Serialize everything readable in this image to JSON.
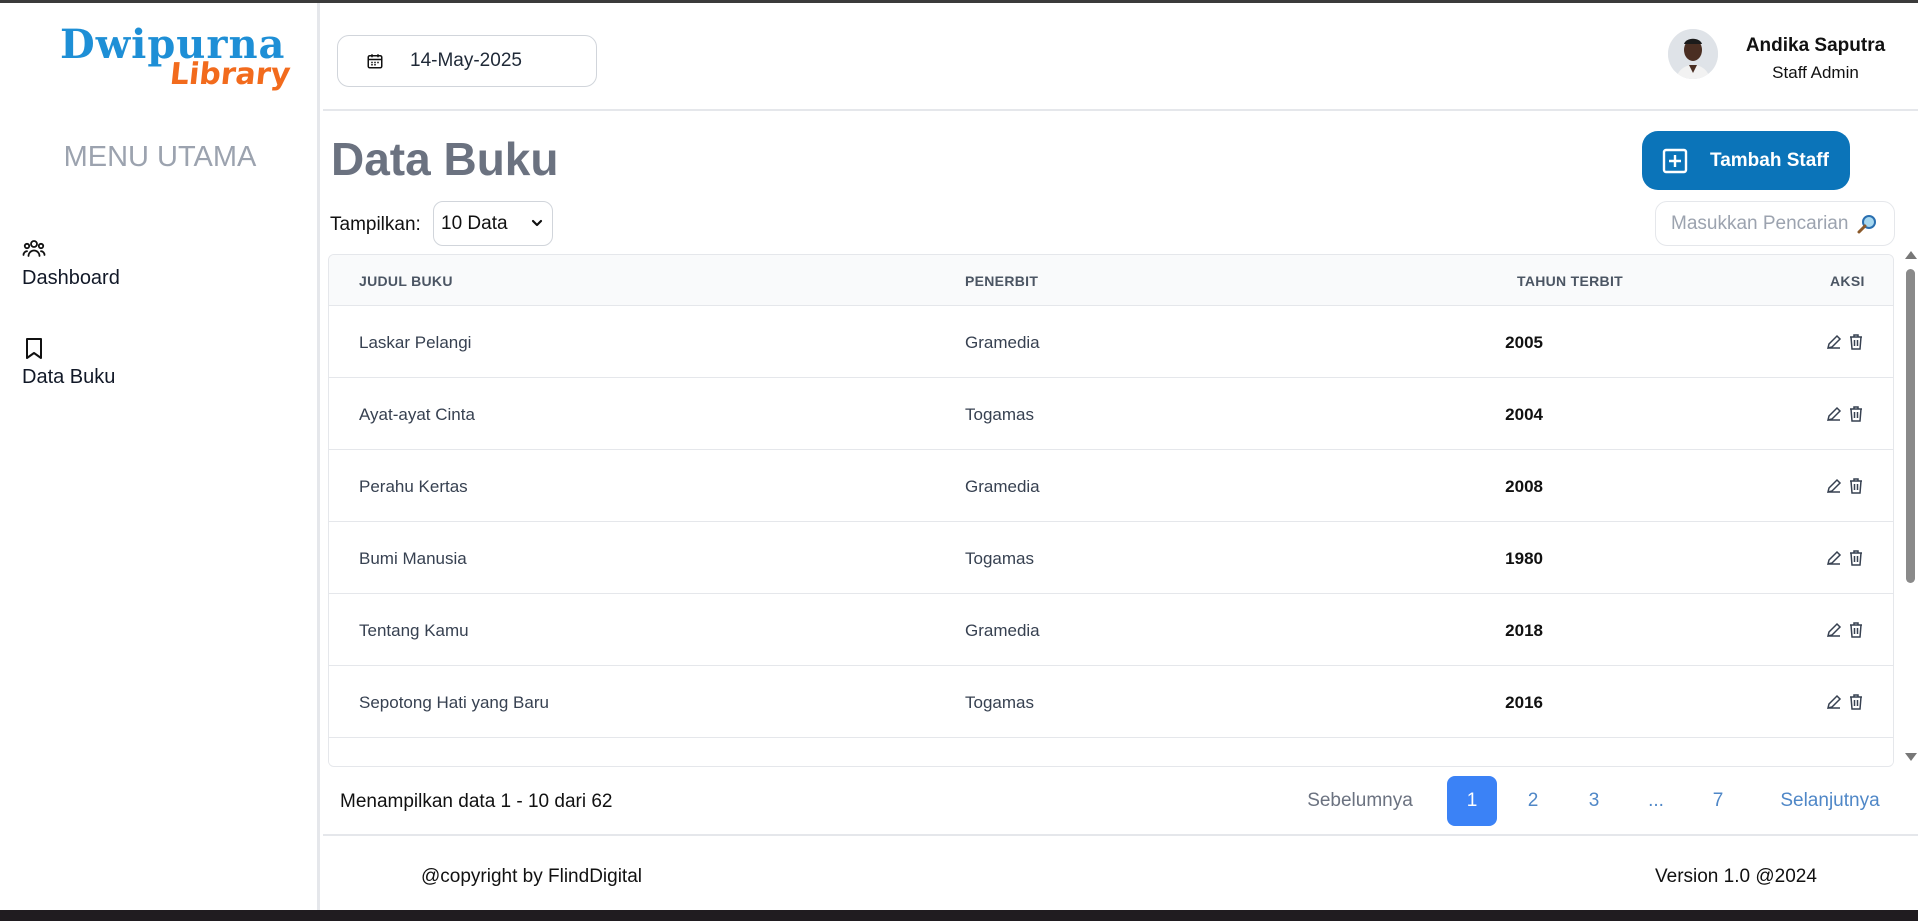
{
  "logo": {
    "line1": "Dwipurna",
    "line2": "Library"
  },
  "sidebar": {
    "menu_title": "MENU UTAMA",
    "items": [
      {
        "label": "Dashboard",
        "icon": "users-icon"
      },
      {
        "label": "Data Buku",
        "icon": "bookmark-icon"
      }
    ]
  },
  "header": {
    "date": "14-May-2025",
    "user": {
      "name": "Andika Saputra",
      "role": "Staff Admin"
    }
  },
  "main": {
    "title": "Data Buku",
    "add_button": "Tambah Staff",
    "show_label": "Tampilkan:",
    "show_value": "10 Data",
    "search_placeholder": "Masukkan Pencarian",
    "table": {
      "headers": [
        "JUDUL BUKU",
        "PENERBIT",
        "TAHUN TERBIT",
        "AKSI"
      ],
      "rows": [
        {
          "judul": "Laskar Pelangi",
          "penerbit": "Gramedia",
          "tahun": "2005"
        },
        {
          "judul": "Ayat-ayat Cinta",
          "penerbit": "Togamas",
          "tahun": "2004"
        },
        {
          "judul": "Perahu Kertas",
          "penerbit": "Gramedia",
          "tahun": "2008"
        },
        {
          "judul": "Bumi Manusia",
          "penerbit": "Togamas",
          "tahun": "1980"
        },
        {
          "judul": "Tentang Kamu",
          "penerbit": "Gramedia",
          "tahun": "2018"
        },
        {
          "judul": "Sepotong Hati yang Baru",
          "penerbit": "Togamas",
          "tahun": "2016"
        }
      ]
    },
    "pagination": {
      "summary": "Menampilkan data 1 - 10 dari 62",
      "prev": "Sebelumnya",
      "pages": [
        "1",
        "2",
        "3",
        "...",
        "7"
      ],
      "active_page": "1",
      "next": "Selanjutnya"
    }
  },
  "footer": {
    "copyright": "@copyright by FlindDigital",
    "version": "Version 1.0 @2024"
  },
  "colors": {
    "primary": "#0b74b9",
    "active_page": "#3b82f6",
    "link": "#4f87c7",
    "logo_blue": "#1e8fd6",
    "logo_orange": "#f26b1d"
  }
}
